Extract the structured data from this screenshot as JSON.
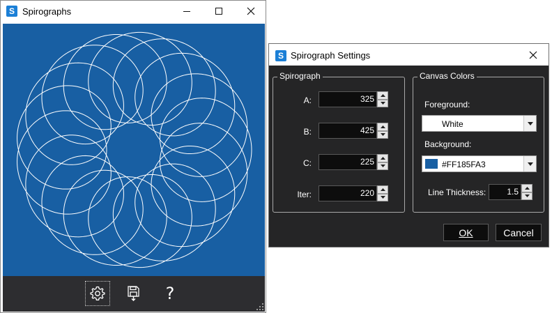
{
  "main_window": {
    "title": "Spirographs",
    "app_icon_letter": "S",
    "canvas": {
      "foreground": "#FFFFFF",
      "background": "#185FA3",
      "line_thickness": 1.5,
      "spirograph": {
        "A": 325,
        "B": 425,
        "C": 225,
        "iter": 220
      }
    },
    "toolbar": {
      "settings_icon": "gear-icon",
      "save_icon": "floppy-download-icon",
      "help_glyph": "?"
    }
  },
  "dialog": {
    "title": "Spirograph Settings",
    "app_icon_letter": "S",
    "spirograph_group": {
      "legend": "Spirograph",
      "fields": [
        {
          "label": "A:",
          "value": "325"
        },
        {
          "label": "B:",
          "value": "425"
        },
        {
          "label": "C:",
          "value": "225"
        },
        {
          "label": "Iter:",
          "value": "220"
        }
      ]
    },
    "colors_group": {
      "legend": "Canvas Colors",
      "foreground_label": "Foreground:",
      "foreground_value": "White",
      "foreground_swatch": "#FFFFFF",
      "background_label": "Background:",
      "background_value": "#FF185FA3",
      "background_swatch": "#185FA3",
      "thickness_label": "Line Thickness:",
      "thickness_value": "1.5"
    },
    "ok_label": "OK",
    "cancel_label": "Cancel"
  }
}
